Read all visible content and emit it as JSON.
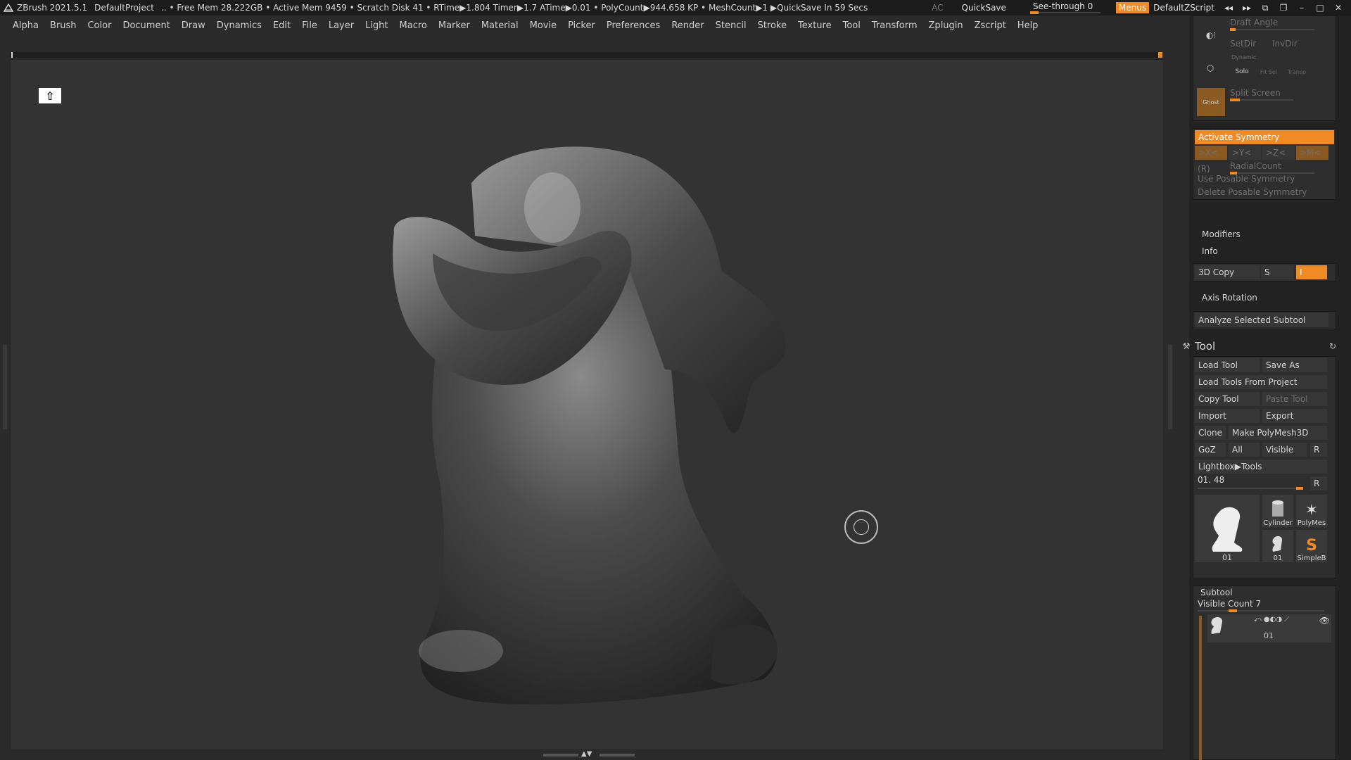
{
  "titlebar": {
    "app": "ZBrush 2021.5.1",
    "project": "DefaultProject",
    "info": ".. • Free Mem 28.222GB • Active Mem 9459 • Scratch Disk 41 •  RTime▶1.804 Timer▶1.7 ATime▶0.01 • PolyCount▶944.658 KP  • MeshCount▶1  ▶QuickSave In 59 Secs",
    "ac": "AC",
    "quicksave": "QuickSave",
    "seethrough": "See-through  0",
    "seethrough_value": 0,
    "menus": "Menus",
    "script": "DefaultZScript"
  },
  "menubar": [
    "Alpha",
    "Brush",
    "Color",
    "Document",
    "Draw",
    "Dynamics",
    "Edit",
    "File",
    "Layer",
    "Light",
    "Macro",
    "Marker",
    "Material",
    "Movie",
    "Picker",
    "Preferences",
    "Render",
    "Stencil",
    "Stroke",
    "Texture",
    "Tool",
    "Transform",
    "Zplugin",
    "Zscript",
    "Help"
  ],
  "canvas": {
    "home_icon": "home-icon"
  },
  "panel": {
    "draft_angle": "Draft Angle",
    "setdir": "SetDir",
    "invdir": "InvDir",
    "dynamic": "Dynamic",
    "solo": "Solo",
    "fit_sel": "Fit Sel",
    "transp": "Transp",
    "ghost": "Ghost",
    "split_screen": "Split Screen",
    "activate_symmetry": "Activate Symmetry",
    "sym_x": ">X<",
    "sym_y": ">Y<",
    "sym_z": ">Z<",
    "sym_m": ">M<",
    "sym_r": "(R)",
    "radial_count": "RadialCount",
    "use_posable": "Use Posable Symmetry",
    "delete_posable": "Delete Posable Symmetry",
    "modifiers": "Modifiers",
    "info": "Info",
    "copy3d": "3D Copy",
    "copy_s": "S",
    "copy_i": "I",
    "axis_rotation": "Axis Rotation",
    "analyze": "Analyze Selected Subtool"
  },
  "tool": {
    "title": "Tool",
    "load_tool": "Load Tool",
    "save_as": "Save As",
    "load_from_project": "Load Tools From Project",
    "copy_tool": "Copy Tool",
    "paste_tool": "Paste Tool",
    "import": "Import",
    "export": "Export",
    "clone": "Clone",
    "make_polymesh": "Make PolyMesh3D",
    "goz": "GoZ",
    "all": "All",
    "visible": "Visible",
    "r": "R",
    "lightbox": "Lightbox▶Tools",
    "slider_label": "01. 48",
    "thumbs": [
      "01",
      "Cylinder",
      "PolyMes",
      "01",
      "SimpleB"
    ]
  },
  "subtool": {
    "title": "Subtool",
    "visible_count": "Visible Count 7",
    "item": "01"
  },
  "colors": {
    "accent": "#f08a24",
    "bg": "#2b2b2b",
    "panel": "#222222"
  }
}
